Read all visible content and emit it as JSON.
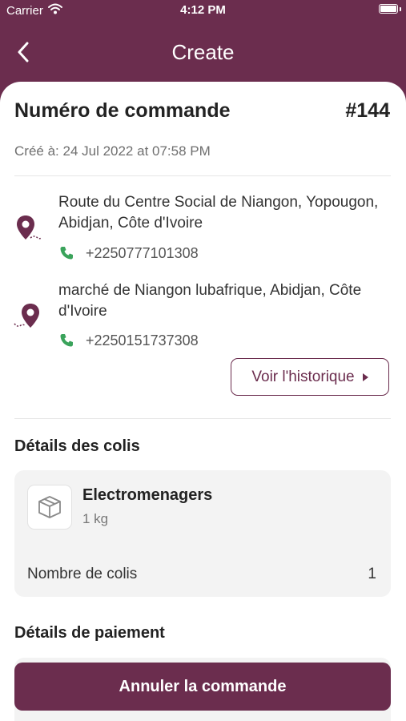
{
  "status_bar": {
    "carrier": "Carrier",
    "time": "4:12 PM"
  },
  "nav": {
    "title": "Create"
  },
  "order": {
    "title": "Numéro de commande",
    "number": "#144",
    "created_label": "Créé à:",
    "created_value": "24 Jul 2022 at 07:58 PM"
  },
  "pickup": {
    "address": "Route du Centre Social de Niangon, Yopougon, Abidjan, Côte d'Ivoire",
    "phone": "+2250777101308"
  },
  "dropoff": {
    "address": "marché de Niangon lubafrique, Abidjan, Côte d'Ivoire",
    "phone": "+2250151737308"
  },
  "history_button": {
    "label": "Voir l'historique"
  },
  "parcels": {
    "section_title": "Détails des colis",
    "item_name": "Electromenagers",
    "item_weight": "1 kg",
    "count_label": "Nombre de colis",
    "count_value": "1"
  },
  "payment": {
    "section_title": "Détails de paiement"
  },
  "cancel_button": {
    "label": "Annuler la commande"
  },
  "colors": {
    "brand": "#6b2d4e",
    "phone_green": "#3aa35b",
    "card_bg": "#f3f3f3"
  },
  "icons": [
    "wifi-icon",
    "battery-icon",
    "back-chevron-icon",
    "location-pin-icon",
    "phone-icon",
    "package-icon",
    "triangle-right-icon"
  ]
}
